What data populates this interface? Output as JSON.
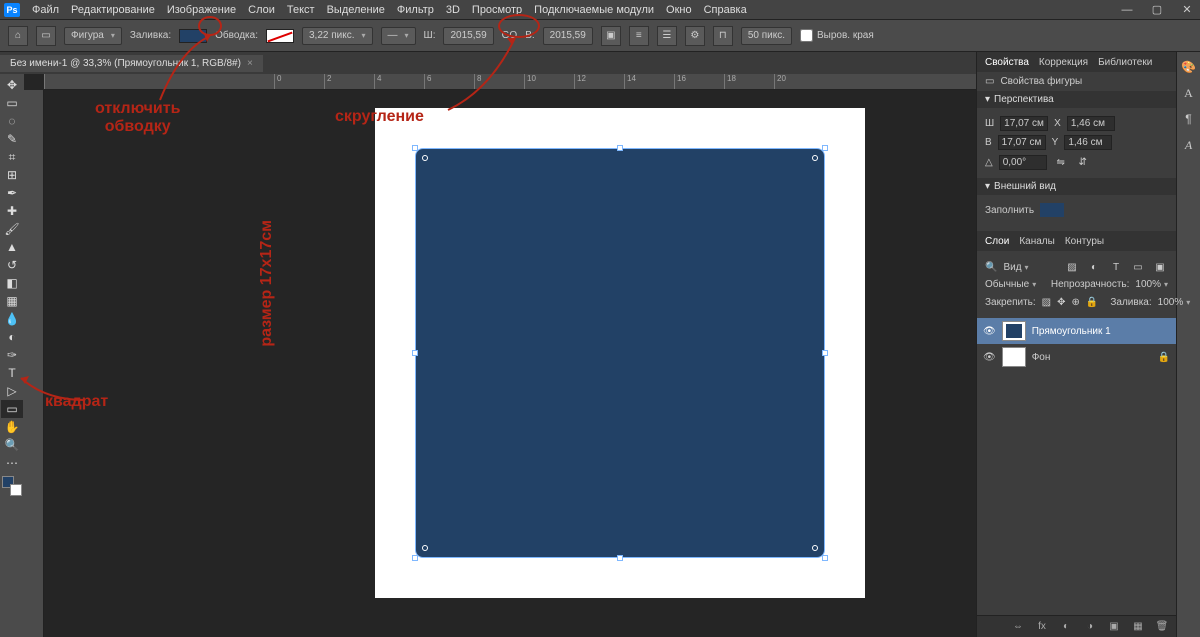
{
  "menubar": {
    "items": [
      "Файл",
      "Редактирование",
      "Изображение",
      "Слои",
      "Текст",
      "Выделение",
      "Фильтр",
      "3D",
      "Просмотр",
      "Подключаемые модули",
      "Окно",
      "Справка"
    ]
  },
  "optionsbar": {
    "home_icon": "home",
    "shape_mode": "Фигура",
    "fill_label": "Заливка:",
    "fill_color": "#224166",
    "stroke_label": "Обводка:",
    "stroke_swatch": "none",
    "stroke_width": "3,22 пикс.",
    "w_label": "Ш:",
    "w_value": "2015,59",
    "h_label": "В:",
    "h_value": "2015,59",
    "link_icon": "GO",
    "radius_value": "50 пикс.",
    "align_label": "Выров. края"
  },
  "doc_tab": {
    "title": "Без имени-1 @ 33,3% (Прямоугольник 1, RGB/8#)"
  },
  "ruler_ticks": [
    "0",
    "2",
    "4",
    "6",
    "8",
    "10",
    "12",
    "14",
    "16",
    "18",
    "20"
  ],
  "properties": {
    "tabs": [
      "Свойства",
      "Коррекция",
      "Библиотеки"
    ],
    "header": "Свойства фигуры",
    "section_transform": "Перспектива",
    "W": "17,07 см",
    "X": "1,46 см",
    "H": "17,07 см",
    "Y": "1,46 см",
    "angle": "0,00°",
    "section_appearance": "Внешний вид",
    "fill_label": "Заполнить",
    "fill_color": "#224166"
  },
  "layers_panel": {
    "tabs": [
      "Слои",
      "Каналы",
      "Контуры"
    ],
    "search": "Вид",
    "blend": "Обычные",
    "opacity_label": "Непрозрачность:",
    "opacity": "100%",
    "lock_label": "Закрепить:",
    "fill_label": "Заливка:",
    "fill": "100%",
    "layers": [
      {
        "name": "Прямоугольник 1",
        "selected": true,
        "thumb": "rect",
        "locked": false
      },
      {
        "name": "Фон",
        "selected": false,
        "thumb": "white",
        "locked": true
      }
    ]
  },
  "annotations": {
    "stroke_off": "отключить\nобводку",
    "rounding": "скругление",
    "size": "размер 17х17см",
    "square": "квадрат"
  }
}
